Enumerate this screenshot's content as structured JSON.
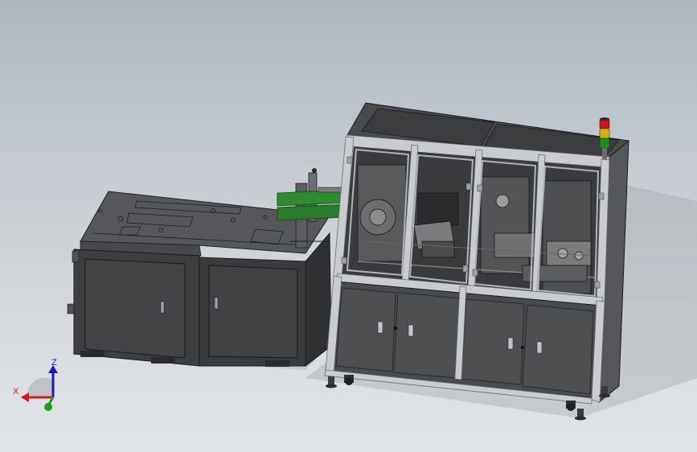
{
  "viewport": {
    "background_top": "#aeb5bd",
    "background_bottom": "#e2e5e8"
  },
  "model": {
    "machine_frame_color": "#c8ccd0",
    "panel_color": "#4a4b4d",
    "glass_color": "#3a3b3d",
    "dark_body_color": "#3d3e40",
    "accent_green": "#2e8a2e",
    "stack_light": [
      "red",
      "yellow",
      "green"
    ]
  },
  "triad": {
    "x_label": "X",
    "z_label": "Z",
    "x_color": "#d01818",
    "y_color": "#18a018",
    "z_color": "#1a1ab8"
  }
}
